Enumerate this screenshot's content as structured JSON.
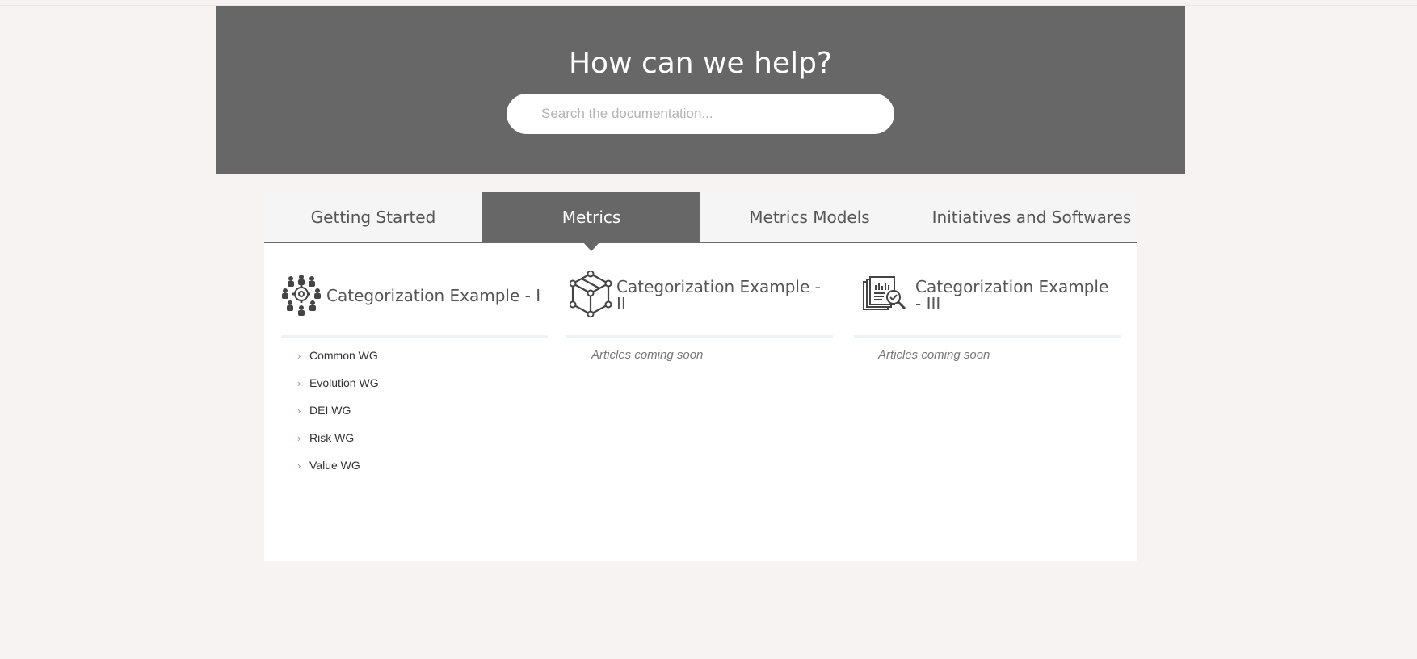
{
  "hero": {
    "title": "How can we help?",
    "search_placeholder": "Search the documentation..."
  },
  "tabs": [
    {
      "label": "Getting Started",
      "active": false
    },
    {
      "label": "Metrics",
      "active": true
    },
    {
      "label": "Metrics Models",
      "active": false
    },
    {
      "label": "Initiatives and Softwares",
      "active": false
    }
  ],
  "categories": [
    {
      "title": "Categorization Example - I",
      "icon": "team-gear-icon",
      "items": [
        "Common WG",
        "Evolution WG",
        "DEI WG",
        "Risk WG",
        "Value WG"
      ]
    },
    {
      "title": "Categorization Example - II",
      "icon": "cube-network-icon",
      "empty_text": "Articles coming soon"
    },
    {
      "title": "Categorization Example - III",
      "icon": "report-search-icon",
      "empty_text": "Articles coming soon"
    }
  ],
  "colors": {
    "hero_bg": "#676767",
    "page_bg": "#f6f3f2",
    "chevron": "#c98b92"
  }
}
